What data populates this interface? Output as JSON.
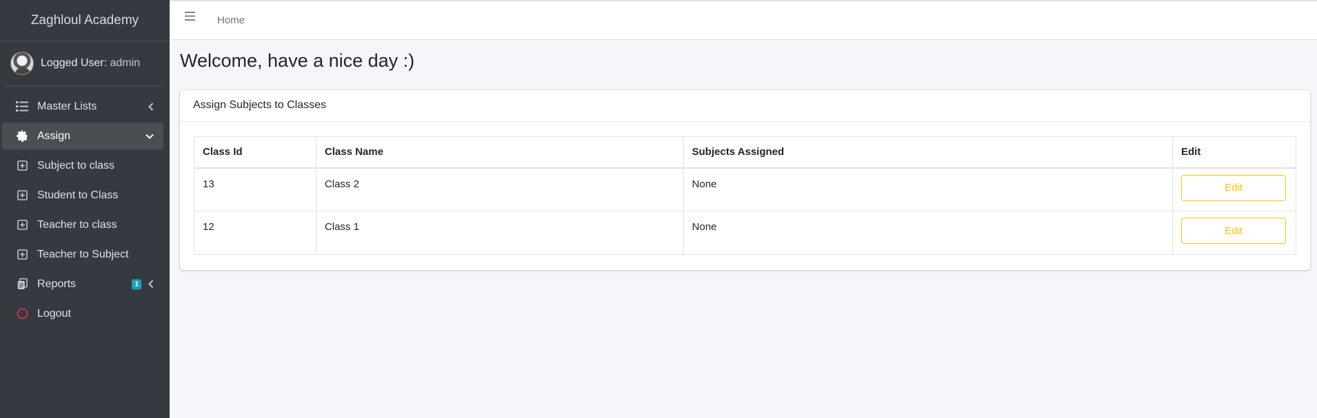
{
  "app": {
    "brand": "Zaghloul Academy"
  },
  "user": {
    "label": "Logged User:",
    "name": "admin"
  },
  "sidebar": {
    "items": [
      {
        "label": "Master Lists",
        "icon": "list-icon"
      },
      {
        "label": "Assign",
        "icon": "gear-icon"
      },
      {
        "label": "Subject to class",
        "icon": "plus-square-icon"
      },
      {
        "label": "Student to Class",
        "icon": "plus-square-icon"
      },
      {
        "label": "Teacher to class",
        "icon": "plus-square-icon"
      },
      {
        "label": "Teacher to Subject",
        "icon": "plus-square-icon"
      },
      {
        "label": "Reports",
        "icon": "copy-icon",
        "badge": "1"
      },
      {
        "label": "Logout",
        "icon": "circle-icon"
      }
    ]
  },
  "topbar": {
    "home": "Home"
  },
  "page": {
    "title": "Welcome, have a nice day :)"
  },
  "card": {
    "title": "Assign Subjects to Classes",
    "columns": [
      "Class Id",
      "Class Name",
      "Subjects Assigned",
      "Edit"
    ],
    "rows": [
      {
        "id": "13",
        "name": "Class 2",
        "subjects": "None",
        "edit": "Edit"
      },
      {
        "id": "12",
        "name": "Class 1",
        "subjects": "None",
        "edit": "Edit"
      }
    ]
  },
  "colors": {
    "sidebar": "#343a40",
    "accent_warning": "#ffc107",
    "badge": "#17a2b8",
    "logout_icon": "#dc3545"
  }
}
